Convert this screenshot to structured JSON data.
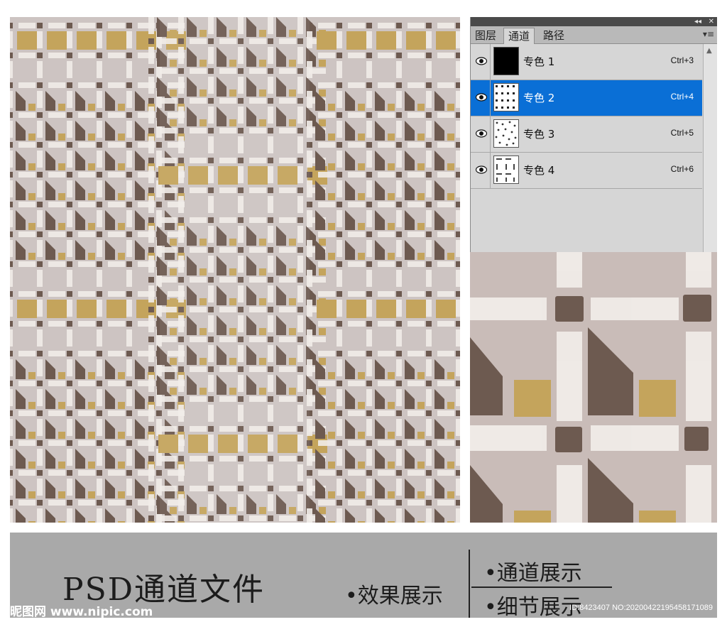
{
  "colors": {
    "background": "#cdc4c2",
    "brown": "#6d5a50",
    "gold": "#c4a45c",
    "white_bar": "#f1ece8",
    "selection": "#0a6fd6"
  },
  "panel": {
    "tabs": [
      {
        "label": "图层",
        "active": false
      },
      {
        "label": "通道",
        "active": true
      },
      {
        "label": "路径",
        "active": false
      }
    ],
    "collapse_glyph": "◂◂",
    "close_glyph": "✕",
    "menu_icon": "panel-menu-icon",
    "channels": [
      {
        "name": "专色 1",
        "shortcut": "Ctrl+3",
        "selected": false,
        "thumb": "black"
      },
      {
        "name": "专色 2",
        "shortcut": "Ctrl+4",
        "selected": true,
        "thumb": "pattern"
      },
      {
        "name": "专色 3",
        "shortcut": "Ctrl+5",
        "selected": false,
        "thumb": "pattern"
      },
      {
        "name": "专色 4",
        "shortcut": "Ctrl+6",
        "selected": false,
        "thumb": "pattern"
      }
    ]
  },
  "banner": {
    "title": "PSD通道文件",
    "effect": "•效果展示",
    "channel_show": "•通道展示",
    "detail_show": "•细节展示"
  },
  "watermark": {
    "left": "昵图网 www.nipic.com",
    "right": "ID:8423407 NO:20200422195458171089"
  }
}
